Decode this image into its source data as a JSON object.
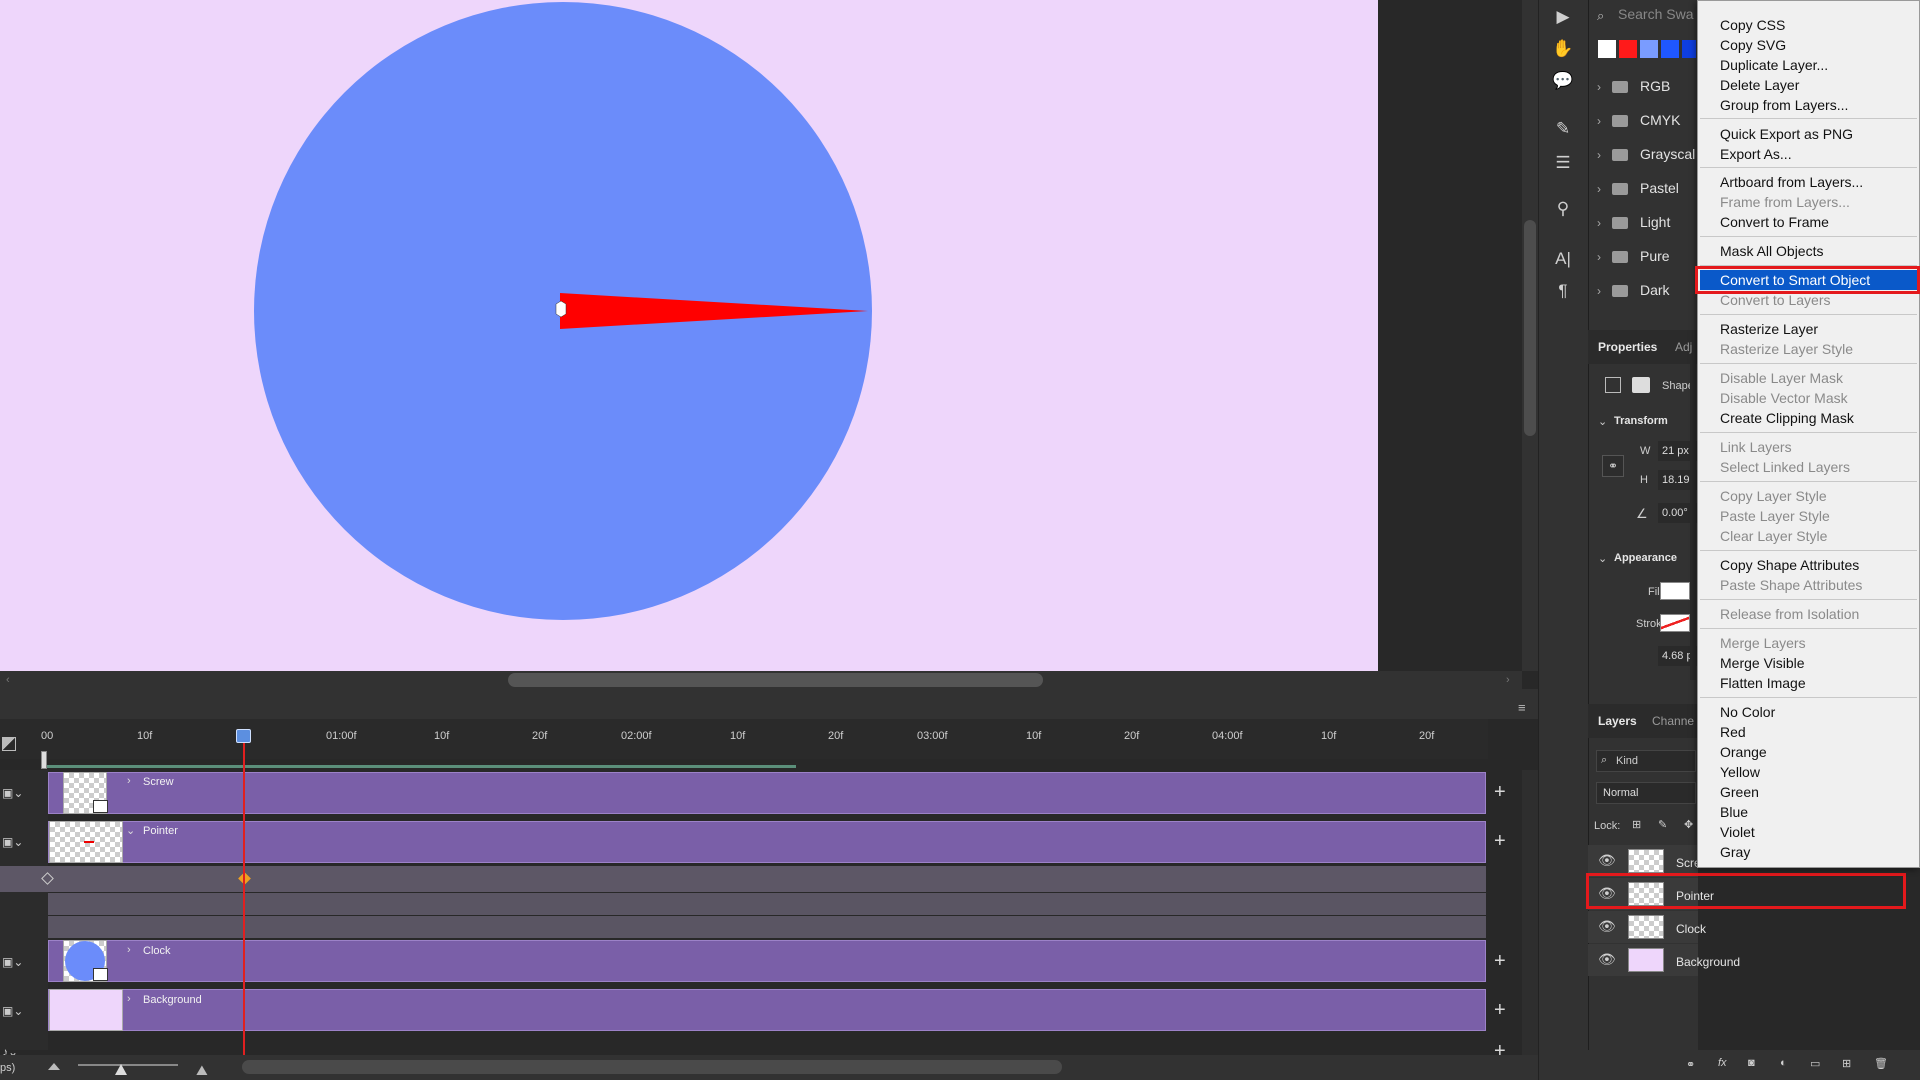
{
  "swatches": {
    "search_placeholder": "Search Swa",
    "colors": [
      "#ffffff",
      "#ff1a1a",
      "#7a9cff",
      "#1f57ff",
      "#0e3ee0"
    ],
    "groups": [
      {
        "label": "RGB"
      },
      {
        "label": "CMYK"
      },
      {
        "label": "Grayscal"
      },
      {
        "label": "Pastel"
      },
      {
        "label": "Light"
      },
      {
        "label": "Pure"
      },
      {
        "label": "Dark"
      }
    ]
  },
  "properties": {
    "tab_properties": "Properties",
    "tab_adjust": "Adj",
    "shape_label": "Shape",
    "transform_title": "Transform",
    "w_label": "W",
    "w_value": "21 px",
    "h_label": "H",
    "h_value": "18.19",
    "angle_value": "0.00°",
    "appearance_title": "Appearance",
    "fill_label": "Fill",
    "stroke_label": "Stroke",
    "stroke_width": "4.68 p"
  },
  "layers_panel": {
    "tab_layers": "Layers",
    "tab_channels": "Channe",
    "kind_label": "Kind",
    "blend_mode": "Normal",
    "lock_label": "Lock:",
    "layers": [
      {
        "name": "Scre"
      },
      {
        "name": "Pointer"
      },
      {
        "name": "Clock"
      },
      {
        "name": "Background"
      }
    ]
  },
  "context_menu": {
    "items": [
      {
        "label": "Copy CSS",
        "enabled": true
      },
      {
        "label": "Copy SVG",
        "enabled": true
      },
      {
        "label": "Duplicate Layer...",
        "enabled": true
      },
      {
        "label": "Delete Layer",
        "enabled": true
      },
      {
        "label": "Group from Layers...",
        "enabled": true
      },
      {
        "label": "Quick Export as PNG",
        "enabled": true
      },
      {
        "label": "Export As...",
        "enabled": true
      },
      {
        "label": "Artboard from Layers...",
        "enabled": true
      },
      {
        "label": "Frame from Layers...",
        "enabled": false
      },
      {
        "label": "Convert to Frame",
        "enabled": true
      },
      {
        "label": "Mask All Objects",
        "enabled": true
      },
      {
        "label": "Convert to Smart Object",
        "enabled": true,
        "selected": true
      },
      {
        "label": "Convert to Layers",
        "enabled": false
      },
      {
        "label": "Rasterize Layer",
        "enabled": true
      },
      {
        "label": "Rasterize Layer Style",
        "enabled": false
      },
      {
        "label": "Disable Layer Mask",
        "enabled": false
      },
      {
        "label": "Disable Vector Mask",
        "enabled": false
      },
      {
        "label": "Create Clipping Mask",
        "enabled": true
      },
      {
        "label": "Link Layers",
        "enabled": false
      },
      {
        "label": "Select Linked Layers",
        "enabled": false
      },
      {
        "label": "Copy Layer Style",
        "enabled": false
      },
      {
        "label": "Paste Layer Style",
        "enabled": false
      },
      {
        "label": "Clear Layer Style",
        "enabled": false
      },
      {
        "label": "Copy Shape Attributes",
        "enabled": true
      },
      {
        "label": "Paste Shape Attributes",
        "enabled": false
      },
      {
        "label": "Release from Isolation",
        "enabled": false
      },
      {
        "label": "Merge Layers",
        "enabled": false
      },
      {
        "label": "Merge Visible",
        "enabled": true
      },
      {
        "label": "Flatten Image",
        "enabled": true
      },
      {
        "label": "No Color",
        "enabled": true
      },
      {
        "label": "Red",
        "enabled": true
      },
      {
        "label": "Orange",
        "enabled": true
      },
      {
        "label": "Yellow",
        "enabled": true
      },
      {
        "label": "Green",
        "enabled": true
      },
      {
        "label": "Blue",
        "enabled": true
      },
      {
        "label": "Violet",
        "enabled": true
      },
      {
        "label": "Gray",
        "enabled": true
      }
    ]
  },
  "timeline": {
    "ruler": [
      "00",
      "10f",
      "01:00f",
      "10f",
      "20f",
      "02:00f",
      "10f",
      "20f",
      "03:00f",
      "10f",
      "20f",
      "04:00f",
      "10f",
      "20f"
    ],
    "tracks": [
      {
        "name": "Screw"
      },
      {
        "name": "Pointer"
      },
      {
        "name": "Clock"
      },
      {
        "name": "Background"
      }
    ],
    "fps_label": "ps)"
  },
  "colors": {
    "artboard": "#eed6fb",
    "clock_face": "#6b8cfa",
    "pointer": "#ff0000",
    "track": "#7a5fa8",
    "menu_highlight": "#0a59c9",
    "callout": "#e4191c"
  }
}
